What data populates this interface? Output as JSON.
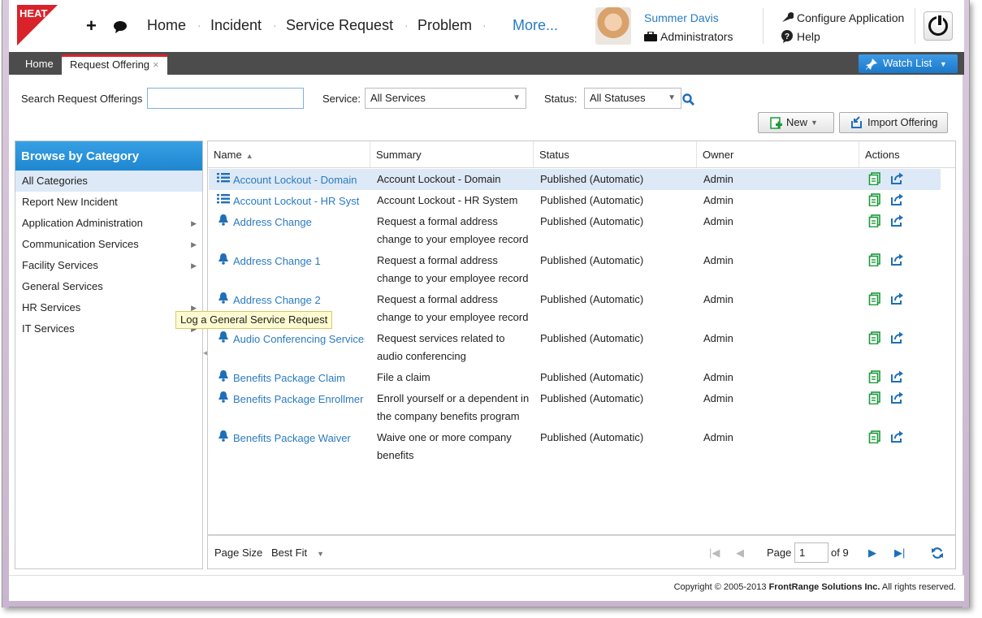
{
  "header": {
    "logo_text": "HEAT",
    "nav": [
      "Home",
      "Incident",
      "Service Request",
      "Problem"
    ],
    "more_label": "More...",
    "user_name": "Summer Davis",
    "user_role": "Administrators",
    "configure_label": "Configure Application",
    "help_label": "Help"
  },
  "tabs": {
    "home": "Home",
    "active": "Request Offering",
    "close_glyph": "×",
    "watch_list": "Watch List"
  },
  "search": {
    "label": "Search Request Offerings",
    "value": "",
    "service_label": "Service:",
    "service_value": "All Services",
    "status_label": "Status:",
    "status_value": "All Statuses"
  },
  "toolbar": {
    "new_label": "New",
    "import_label": "Import Offering"
  },
  "categories": {
    "title": "Browse by Category",
    "items": [
      {
        "label": "All Categories"
      },
      {
        "label": "Report New Incident"
      },
      {
        "label": "Application Administration"
      },
      {
        "label": "Communication Services"
      },
      {
        "label": "Facility Services"
      },
      {
        "label": "General Services"
      },
      {
        "label": "HR Services"
      },
      {
        "label": "IT Services"
      }
    ],
    "tooltip": "Log a General Service Request"
  },
  "grid": {
    "columns": [
      "Name",
      "Summary",
      "Status",
      "Owner",
      "Actions"
    ],
    "rows": [
      {
        "icon": "list-icon",
        "name": "Account Lockout - Domain",
        "summary": [
          "Account Lockout - Domain"
        ],
        "status": "Published (Automatic)",
        "owner": "Admin"
      },
      {
        "icon": "list-icon",
        "name": "Account Lockout - HR Syst",
        "summary": [
          "Account Lockout - HR System"
        ],
        "status": "Published (Automatic)",
        "owner": "Admin"
      },
      {
        "icon": "bell-icon",
        "name": "Address Change",
        "summary": [
          "Request a formal address",
          "change to your employee record"
        ],
        "status": "Published (Automatic)",
        "owner": "Admin"
      },
      {
        "icon": "bell-icon",
        "name": "Address Change 1",
        "summary": [
          "Request a formal address",
          "change to your employee record"
        ],
        "status": "Published (Automatic)",
        "owner": "Admin"
      },
      {
        "icon": "bell-icon",
        "name": "Address Change 2",
        "summary": [
          "Request a formal address",
          "change to your employee record"
        ],
        "status": "Published (Automatic)",
        "owner": "Admin"
      },
      {
        "icon": "bell-icon",
        "name": "Audio Conferencing Services",
        "summary": [
          "Request services related to",
          "audio conferencing"
        ],
        "status": "Published (Automatic)",
        "owner": "Admin"
      },
      {
        "icon": "bell-icon",
        "name": "Benefits Package Claim",
        "summary": [
          "File a claim"
        ],
        "status": "Published (Automatic)",
        "owner": "Admin"
      },
      {
        "icon": "bell-icon",
        "name": "Benefits Package Enrollmer",
        "summary": [
          "Enroll yourself or a dependent in",
          "the company benefits program"
        ],
        "status": "Published (Automatic)",
        "owner": "Admin"
      },
      {
        "icon": "bell-icon",
        "name": "Benefits Package Waiver",
        "summary": [
          "Waive one or more company",
          "benefits"
        ],
        "status": "Published (Automatic)",
        "owner": "Admin"
      }
    ]
  },
  "pager": {
    "page_size_label": "Page Size",
    "page_size_value": "Best Fit",
    "page_label": "Page",
    "page_value": "1",
    "of_label": "of 9"
  },
  "footer": {
    "copyright_prefix": "Copyright © 2005-2013 ",
    "company": "FrontRange Solutions Inc.",
    "suffix": " All rights reserved."
  },
  "colors": {
    "accent": "#2a7bc0",
    "brand_red": "#d8232a",
    "action_green": "#1a9a3a",
    "tabbar": "#4c4c4c"
  }
}
